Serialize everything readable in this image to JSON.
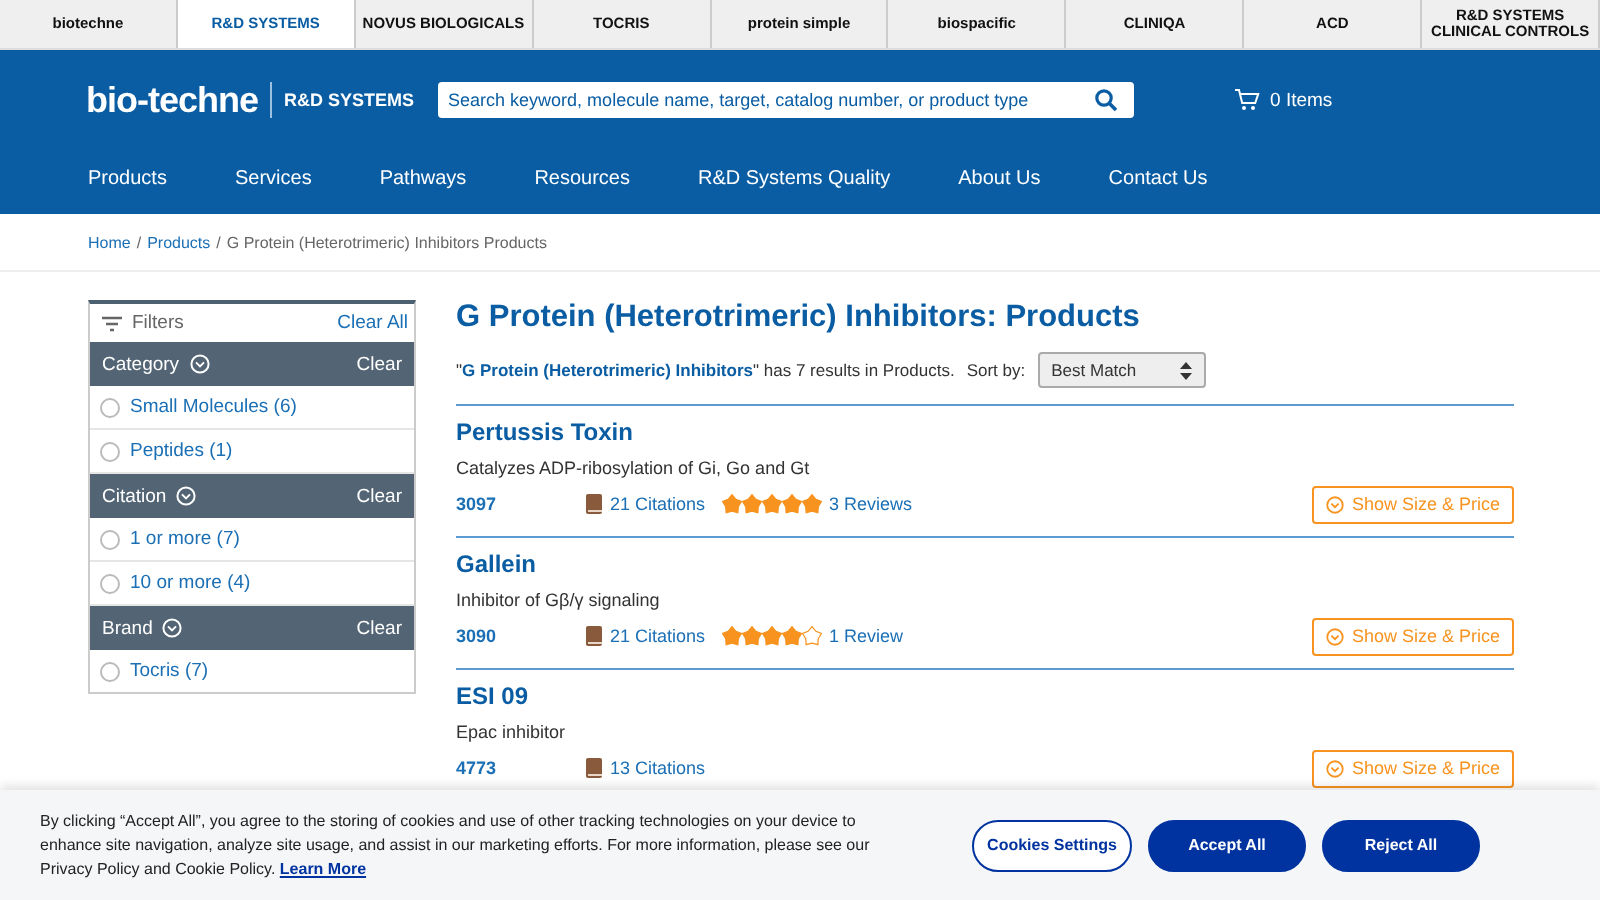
{
  "brand_bar": [
    {
      "label": "biotechne",
      "selected": false
    },
    {
      "label": "R&D SYSTEMS",
      "selected": true
    },
    {
      "label": "NOVUS BIOLOGICALS",
      "selected": false
    },
    {
      "label": "TOCRIS",
      "selected": false
    },
    {
      "label": "protein simple",
      "selected": false
    },
    {
      "label": "biospacific",
      "selected": false
    },
    {
      "label": "CLINIQA",
      "selected": false
    },
    {
      "label": "ACD",
      "selected": false
    },
    {
      "label": "R&D SYSTEMS CLINICAL CONTROLS",
      "selected": false
    }
  ],
  "header": {
    "logo": "bio-techne",
    "sublogo": "R&D SYSTEMS",
    "search": {
      "placeholder": "Search keyword, molecule name, target, catalog number, or product type"
    },
    "cart": "0 Items"
  },
  "nav": [
    "Products",
    "Services",
    "Pathways",
    "Resources",
    "R&D Systems Quality",
    "About Us",
    "Contact Us"
  ],
  "breadcrumb": [
    {
      "label": "Home",
      "link": true,
      "separator": "/"
    },
    {
      "label": "Products",
      "link": true,
      "separator": "/"
    },
    {
      "label": "G Protein (Heterotrimeric) Inhibitors Products",
      "link": false
    }
  ],
  "filters": {
    "title": "Filters",
    "clear_all": "Clear All",
    "groups": [
      {
        "name": "Category",
        "clear": "Clear",
        "options": [
          {
            "label": "Small Molecules (6)",
            "checked": false
          },
          {
            "label": "Peptides (1)",
            "checked": false
          }
        ]
      },
      {
        "name": "Citation",
        "clear": "Clear",
        "options": [
          {
            "label": "1 or more (7)",
            "checked": false
          },
          {
            "label": "10 or more (4)",
            "checked": false
          }
        ]
      },
      {
        "name": "Brand",
        "clear": "Clear",
        "options": [
          {
            "label": "Tocris (7)",
            "checked": false
          }
        ]
      }
    ]
  },
  "page_title": "G Protein (Heterotrimeric) Inhibitors: Products",
  "summary": "\"**G Protein (Heterotrimeric) Inhibitors**\" has 7 results in Products.",
  "sort": {
    "label": "Sort by:",
    "value": "Best Match"
  },
  "products": [
    {
      "name": "Pertussis Toxin",
      "description": "Catalyzes ADP-ribosylation of Gi, Go and Gt",
      "catalog": "3097",
      "citations": "21 Citations",
      "stars": 5,
      "reviews": "3 Reviews",
      "button": "Show Size & Price"
    },
    {
      "name": "Gallein",
      "description": "Inhibitor of Gβ/γ signaling",
      "catalog": "3090",
      "citations": "21 Citations",
      "stars": 4,
      "reviews": "1 Review",
      "button": "Show Size & Price"
    },
    {
      "name": "ESI 09",
      "description": "Epac inhibitor",
      "catalog": "4773",
      "citations": "13 Citations",
      "button": "Show Size & Price"
    }
  ],
  "cookie_banner": {
    "text": "By clicking “Accept All”, you agree to the storing of cookies and use of other tracking technologies on your device to enhance site navigation, analyze site usage, and assist in our marketing efforts. For more information, please see our Privacy Policy and Cookie Policy.",
    "link": "Learn More",
    "buttons": [
      "Cookies Settings",
      "Accept All",
      "Reject All"
    ]
  }
}
